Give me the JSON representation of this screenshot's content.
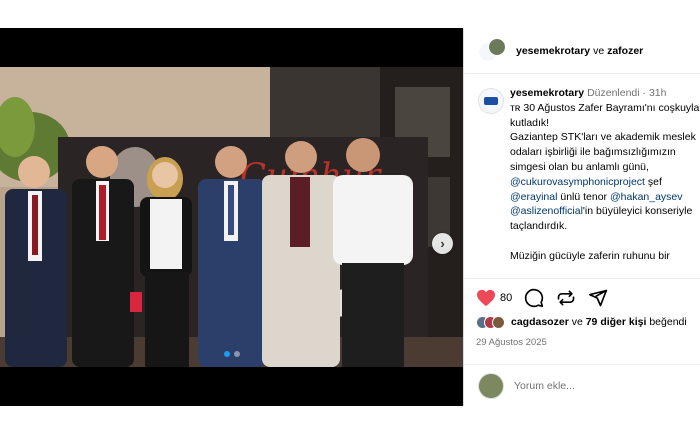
{
  "post": {
    "collab_users": "yesemekrotary",
    "collab_sep": "ve",
    "collab_user2": "zafozer",
    "caption_user": "yesemekrotary",
    "edited_label": "Düzenlendi",
    "time_sep": "·",
    "time_ago": "31h",
    "caption_lines": [
      {
        "prefix": "ᴛʀ 30 Ağustos Zafer Bayramı'nı coşkuyla",
        "mention": "",
        "suffix": ""
      },
      {
        "prefix": "kutladık!",
        "mention": "",
        "suffix": ""
      },
      {
        "prefix": "Gaziantep STK'ları ve akademik meslek",
        "mention": "",
        "suffix": ""
      },
      {
        "prefix": "odaları işbirliği ile bağımsızlığımızın",
        "mention": "",
        "suffix": ""
      },
      {
        "prefix": "simgesi olan bu anlamlı günü,",
        "mention": "",
        "suffix": ""
      },
      {
        "prefix": "",
        "mention": "@cukurovasymphonicproject",
        "suffix": " şef"
      },
      {
        "prefix": "",
        "mention": "@erayinal",
        "suffix": " ünlü tenor "
      },
      {
        "prefix": "",
        "mention": "@aslizenofficial",
        "suffix": "'in büyüleyici konseriyle"
      },
      {
        "prefix": "taçlandırdık.",
        "mention": "",
        "suffix": ""
      },
      {
        "prefix": "",
        "mention": "",
        "suffix": ""
      },
      {
        "prefix": "Müziğin gücüyle zaferin ruhunu bir",
        "mention": "",
        "suffix": ""
      }
    ],
    "tenor_mention": "@hakan_aysev",
    "like_count": "80",
    "liked_by_user": "cagdasozer",
    "liked_by_sep": "ve",
    "liked_by_others": "79 diğer kişi",
    "liked_by_suffix": "beğendi",
    "date": "29 Ağustos 2025",
    "comment_placeholder": "Yorum ekle...",
    "next_icon": "chevron-right-icon",
    "carousel_dots": 2,
    "carousel_active": 0
  },
  "colors": {
    "heart": "#ed4956",
    "mention": "#00376b",
    "muted": "#737373",
    "dot_active": "#1d9bf0"
  }
}
